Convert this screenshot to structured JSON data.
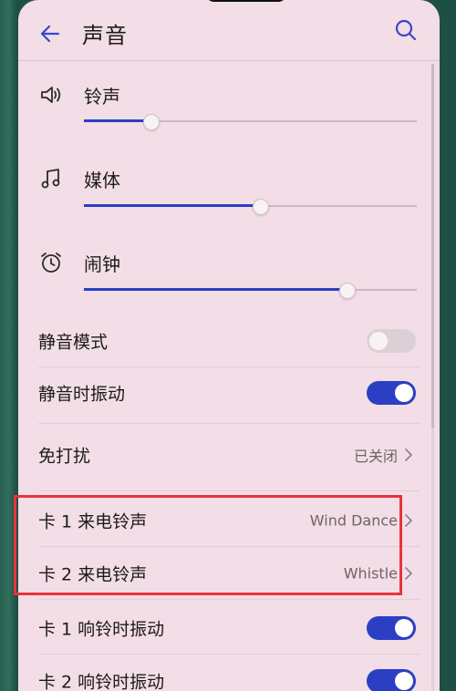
{
  "header": {
    "title": "声音",
    "back_icon": "arrow-left-icon",
    "search_icon": "search-icon"
  },
  "volumes": [
    {
      "id": "ringtone",
      "label": "铃声",
      "icon": "speaker-icon",
      "level": 0.2
    },
    {
      "id": "media",
      "label": "媒体",
      "icon": "music-note-icon",
      "level": 0.53
    },
    {
      "id": "alarm",
      "label": "闹钟",
      "icon": "alarm-clock-icon",
      "level": 0.79
    }
  ],
  "settings": {
    "silent_mode": {
      "label": "静音模式",
      "on": false
    },
    "vibrate_silent": {
      "label": "静音时振动",
      "on": true
    },
    "dnd": {
      "label": "免打扰",
      "value": "已关闭"
    },
    "card1_ringtone": {
      "label": "卡 1 来电铃声",
      "value": "Wind Dance"
    },
    "card2_ringtone": {
      "label": "卡 2 来电铃声",
      "value": "Whistle"
    },
    "card1_vibrate": {
      "label": "卡 1 响铃时振动",
      "on": true
    },
    "card2_vibrate": {
      "label": "卡 2 响铃时振动",
      "on": true
    }
  },
  "colors": {
    "accent": "#2a3fc4",
    "background": "#f3dde6",
    "highlight": "#e8333b"
  }
}
